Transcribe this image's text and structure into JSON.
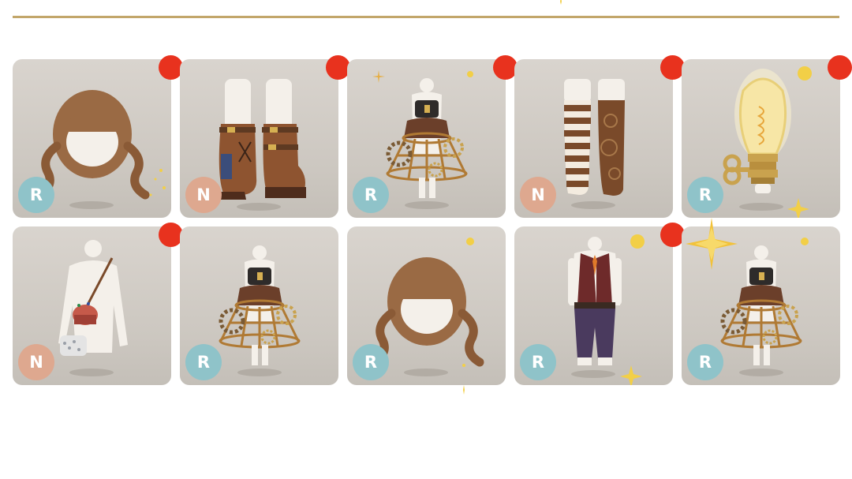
{
  "colors": {
    "divider": "#c2a66a",
    "card_bg": "#d3cec8",
    "rarity_r": "#8fc3c9",
    "rarity_n": "#dea88f",
    "new_dot": "#e8321e",
    "sparkle": "#f2cf47"
  },
  "items": [
    {
      "icon": "curly-pigtail-hair-icon",
      "rarity": "R",
      "is_new": true
    },
    {
      "icon": "buckled-boots-icon",
      "rarity": "N",
      "is_new": true
    },
    {
      "icon": "steampunk-cage-skirt-icon",
      "rarity": "R",
      "is_new": true
    },
    {
      "icon": "striped-gear-stockings-icon",
      "rarity": "N",
      "is_new": true
    },
    {
      "icon": "lightbulb-accessory-icon",
      "rarity": "R",
      "is_new": true
    },
    {
      "icon": "pincushion-satchel-icon",
      "rarity": "N",
      "is_new": true
    },
    {
      "icon": "steampunk-cage-skirt-icon",
      "rarity": "R",
      "is_new": false
    },
    {
      "icon": "curly-pigtail-hair-icon",
      "rarity": "R",
      "is_new": false
    },
    {
      "icon": "vest-outfit-icon",
      "rarity": "R",
      "is_new": true
    },
    {
      "icon": "steampunk-cage-skirt-icon",
      "rarity": "R",
      "is_new": false
    }
  ]
}
